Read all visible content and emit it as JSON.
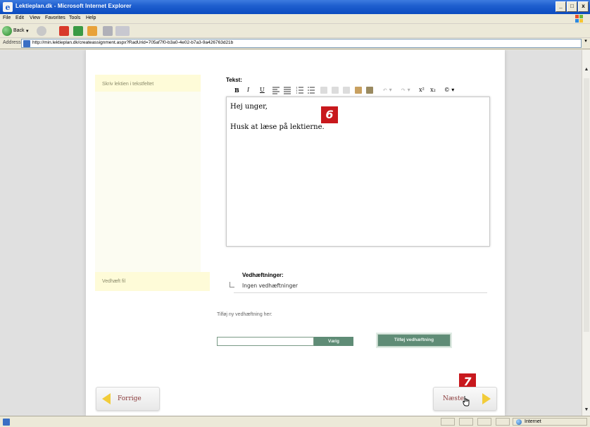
{
  "window": {
    "title": "Lektieplan.dk - Microsoft Internet Explorer",
    "buttons": {
      "minimize": "_",
      "maximize": "□",
      "close": "x"
    }
  },
  "menu": [
    "File",
    "Edit",
    "View",
    "Favorites",
    "Tools",
    "Help"
  ],
  "toolbar": {
    "back_label": "Back",
    "dropdown": "▾"
  },
  "address": {
    "label": "Address",
    "url": "http://min.lektieplan.dk/createassignment.aspx?RadUrid=705af7f0-b3a0-4e02-b7a3-9a426763d21b",
    "dropdown": "▾"
  },
  "form": {
    "write_label": "Skriv lektien i tekstfeltet",
    "editor_title": "Tekst:",
    "editor_toolbar": {
      "bold": "B",
      "italic": "I",
      "underline": "U",
      "superscript": "x²",
      "subscript": "x₂",
      "more": "© ▾"
    },
    "editor_lines": [
      "Hej unger,",
      "Husk at læse på lektierne."
    ],
    "attach_label": "Vedhæft fil",
    "attachments_heading": "Vedhæftninger:",
    "attachments_none": "Ingen vedhæftninger",
    "add_attachment_label": "Tilføj ny vedhæftning her:",
    "file_input_value": "",
    "choose_button": "Vælg",
    "add_attachment_button": "Tilføj vedhæftning",
    "prev_button": "Forrige",
    "next_button": "Næste"
  },
  "markers": {
    "editor": "6",
    "next": "7"
  },
  "statusbar": {
    "zone": "Internet"
  },
  "colors": {
    "accent_green": "#5f8c76",
    "label_yellow": "#fefbd8",
    "marker_red": "#c8181d",
    "arrow_yellow": "#f2cc3a"
  }
}
